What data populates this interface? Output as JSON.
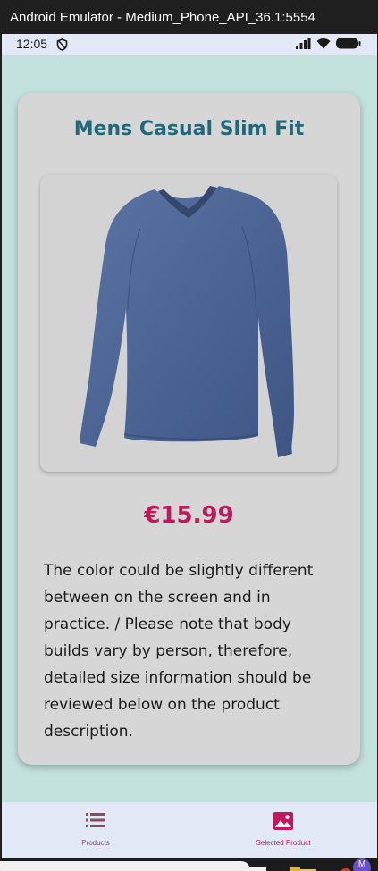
{
  "window": {
    "title": "Android Emulator - Medium_Phone_API_36.1:5554"
  },
  "status_bar": {
    "time": "12:05"
  },
  "product": {
    "title": "Mens Casual Slim Fit",
    "price": "€15.99",
    "description": "The color could be slightly different between on the screen and in practice. / Please note that body builds vary by person, therefore, detailed size information should be reviewed below on the product description."
  },
  "bottom_nav": {
    "items": [
      {
        "label": "Products",
        "icon": "list-icon",
        "selected": false
      },
      {
        "label": "Selected Product",
        "icon": "image-icon",
        "selected": true
      }
    ]
  },
  "taskbar": {
    "avatar_letter": "M"
  },
  "colors": {
    "background": "#c3e1dd",
    "card": "#d6d6d6",
    "title": "#1e6a7a",
    "price": "#c2185b",
    "nav_bar": "#e3e8f7"
  }
}
